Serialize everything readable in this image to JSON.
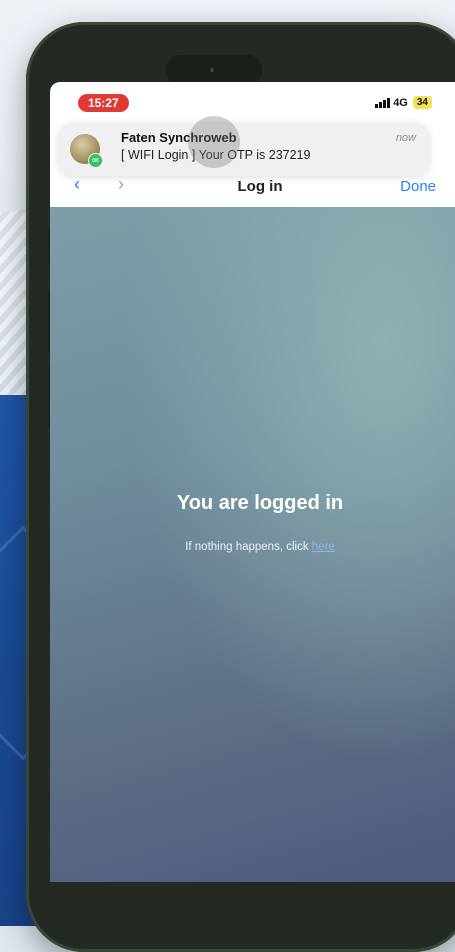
{
  "status_bar": {
    "time": "15:27",
    "network": "4G",
    "battery": "34"
  },
  "notification": {
    "sender": "Faten Synchroweb",
    "message": "[ WIFI Login ] Your OTP is 237219",
    "time": "now",
    "badge_color": "#36c25a"
  },
  "nav": {
    "title": "Log in",
    "done_label": "Done",
    "back_symbol": "‹",
    "forward_symbol": "›"
  },
  "content": {
    "title": "You are logged in",
    "subtitle_prefix": "If nothing happens, click ",
    "link_text": "here"
  },
  "colors": {
    "time_pill": "#e03a35",
    "battery": "#f3e15a",
    "accent": "#2f7ff0"
  }
}
